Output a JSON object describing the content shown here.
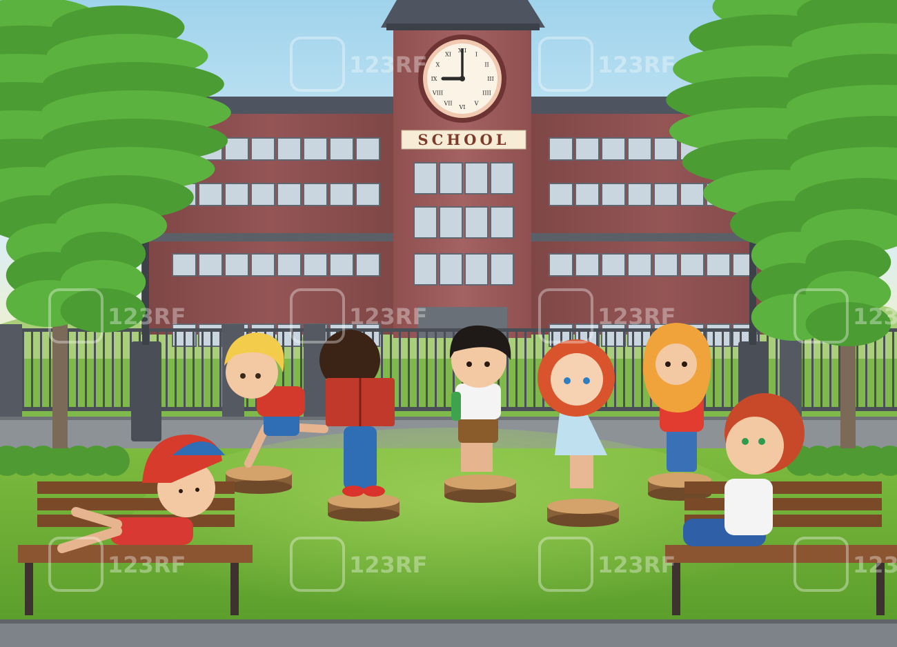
{
  "scene": {
    "sign_text": "SCHOOL",
    "watermark_text": "123RF",
    "clock_numerals": [
      "XII",
      "I",
      "II",
      "III",
      "IIII",
      "V",
      "VI",
      "VII",
      "VIII",
      "IX",
      "X",
      "XI"
    ],
    "clock_time": "9:00",
    "colors": {
      "sky": "#bfe3f2",
      "building": "#8a4e4e",
      "tower": "#9a5858",
      "roof": "#4e5560",
      "window": "#c9d6e0",
      "grass": "#6cae34",
      "path": "#8c9296",
      "bench": "#7a4a28",
      "tree_foliage": "#52a83a",
      "fence": "#4a4f57"
    }
  }
}
